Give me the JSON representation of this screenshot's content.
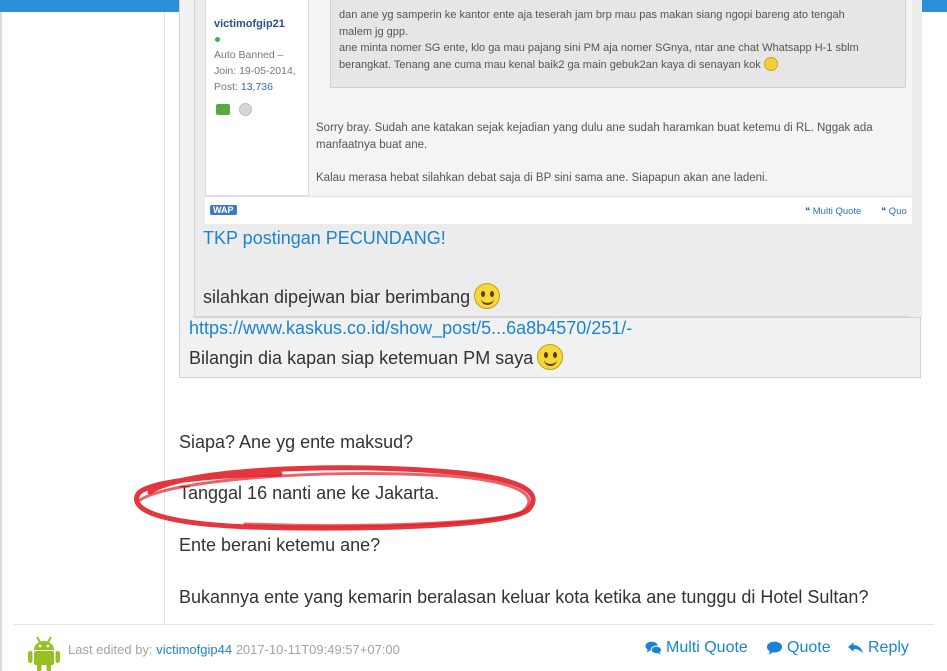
{
  "screenshot": {
    "username": "victimofgip21",
    "status_line1": "Auto Banned –",
    "status_line2": "Join: 19-05-2014,",
    "post_label": "Post:",
    "post_count": "13,736",
    "nested_line1": "dan ane yg samperin ke kantor ente aja teserah jam brp mau pas makan siang ngopi bareng ato tengah",
    "nested_line2": "malem jg gpp.",
    "nested_line3": "ane minta nomer SG ente, klo ga mau pajang sini PM aja nomer SGnya, ntar ane chat Whatsapp H-1 sblm",
    "nested_line4": "berangkat. Tenang ane cuma mau kenal baik2 ga main gebuk2an kaya di senayan kok",
    "body_p1": "Sorry bray. Sudah ane katakan sejak kejadian yang dulu ane sudah haramkan buat ketemu di RL. Nggak ada manfaatnya buat ane.",
    "body_p2": "Kalau merasa hebat silahkan debat saja di BP sini sama ane. Siapapun akan ane ladeni.",
    "wap_label": "WAP",
    "multi_quote": "Multi Quote",
    "quote_partial": "Quo"
  },
  "inner_quote": {
    "link_text": "TKP postingan PECUNDANG!",
    "text": "silahkan dipejwan biar berimbang"
  },
  "outer_quote": {
    "link_text": "https://www.kaskus.co.id/show_post/5...6a8b4570/251/-",
    "text": "Bilangin dia kapan siap ketemuan PM saya"
  },
  "post": {
    "line1": "Siapa? Ane yg ente maksud?",
    "line2": "Tanggal 16 nanti ane ke Jakarta.",
    "line3": "Ente berani ketemu ane?",
    "line4": "Bukannya ente yang kemarin beralasan keluar kota ketika ane tunggu di Hotel Sultan?"
  },
  "footer": {
    "edited_label": "Last edited by:",
    "edited_user": "victimofgip44",
    "edited_time": "2017-10-11T09:49:57+07:00",
    "multi_quote": "Multi Quote",
    "quote": "Quote",
    "reply": "Reply"
  },
  "colors": {
    "accent": "#1a83d6",
    "top_bar": "#2a8fd8",
    "circle_annotation": "#e0202a",
    "android_green": "#97c024"
  }
}
